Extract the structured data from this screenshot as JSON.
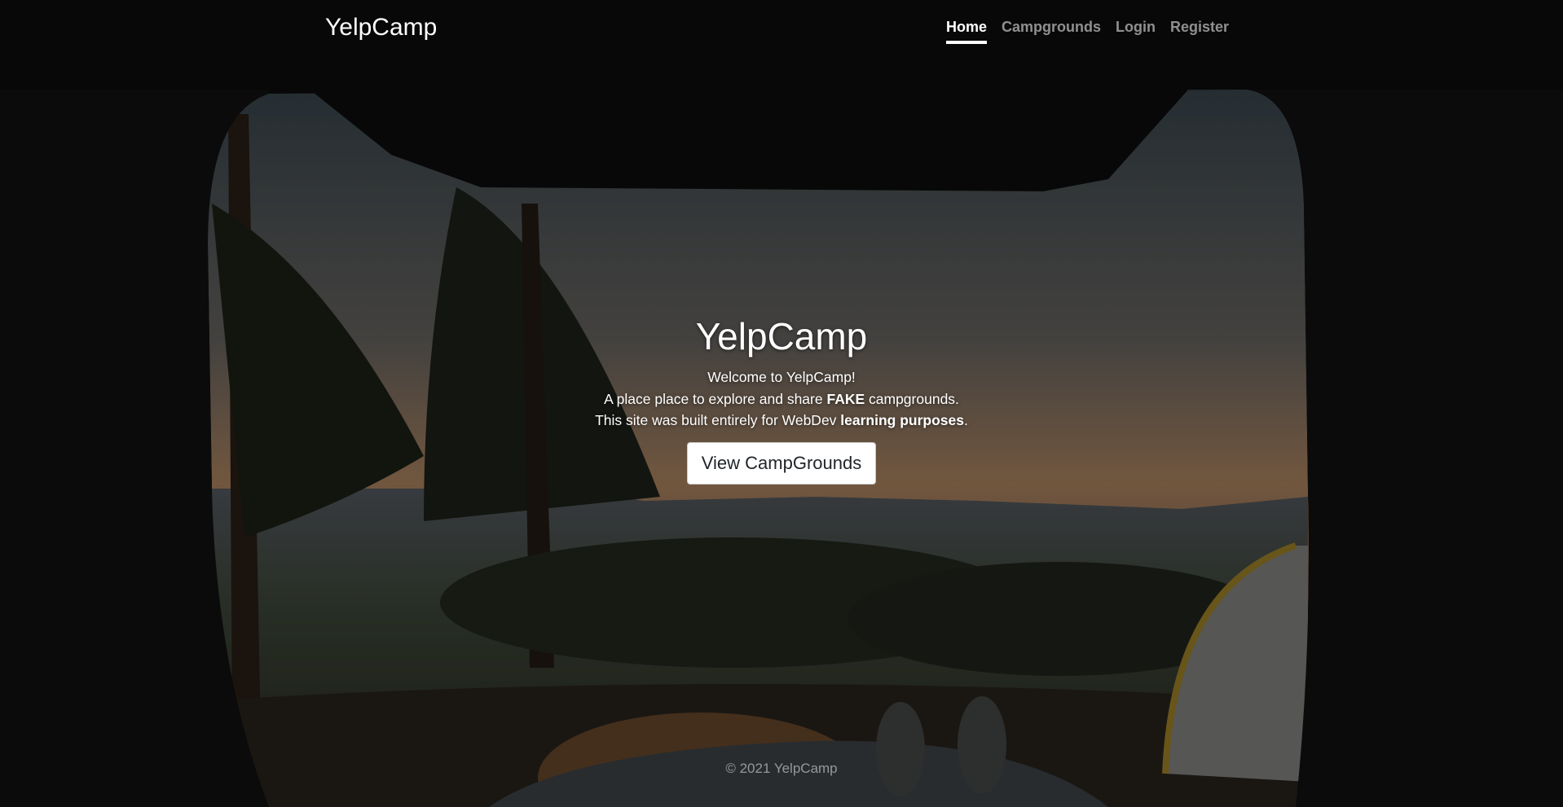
{
  "brand": "YelpCamp",
  "nav": {
    "home": "Home",
    "campgrounds": "Campgrounds",
    "login": "Login",
    "register": "Register"
  },
  "hero": {
    "title": "YelpCamp",
    "line1": "Welcome to YelpCamp!",
    "line2_pre": "A place place to explore and share ",
    "line2_bold": "FAKE",
    "line2_post": " campgrounds.",
    "line3_pre": "This site was built entirely for WebDev ",
    "line3_bold": "learning purposes",
    "line3_post": ".",
    "button": "View CampGrounds"
  },
  "footer": "© 2021 YelpCamp"
}
